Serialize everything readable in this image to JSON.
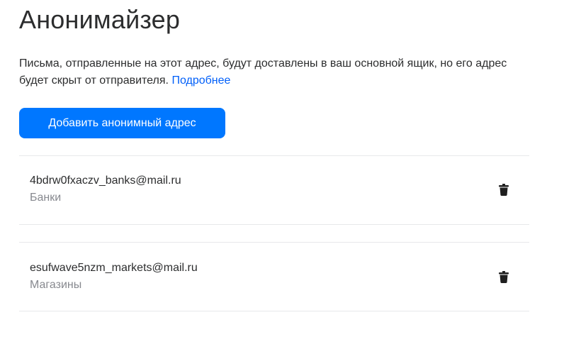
{
  "page": {
    "title": "Анонимайзер",
    "description": "Письма, отправленные на этот адрес, будут доставлены в ваш основной ящик, но его адрес будет скрыт от отправителя.",
    "more_link": "Подробнее"
  },
  "actions": {
    "add_label": "Добавить анонимный адрес"
  },
  "addresses": [
    {
      "email": "4bdrw0fxaczv_banks@mail.ru",
      "label": "Банки",
      "delete_icon": "trash-icon"
    },
    {
      "email": "esufwave5nzm_markets@mail.ru",
      "label": "Магазины",
      "delete_icon": "trash-icon"
    }
  ],
  "colors": {
    "accent": "#0077ff",
    "link": "#005ff9",
    "text": "#2c2d2e",
    "secondary_text": "#87898f",
    "divider": "#e7e8ea"
  }
}
